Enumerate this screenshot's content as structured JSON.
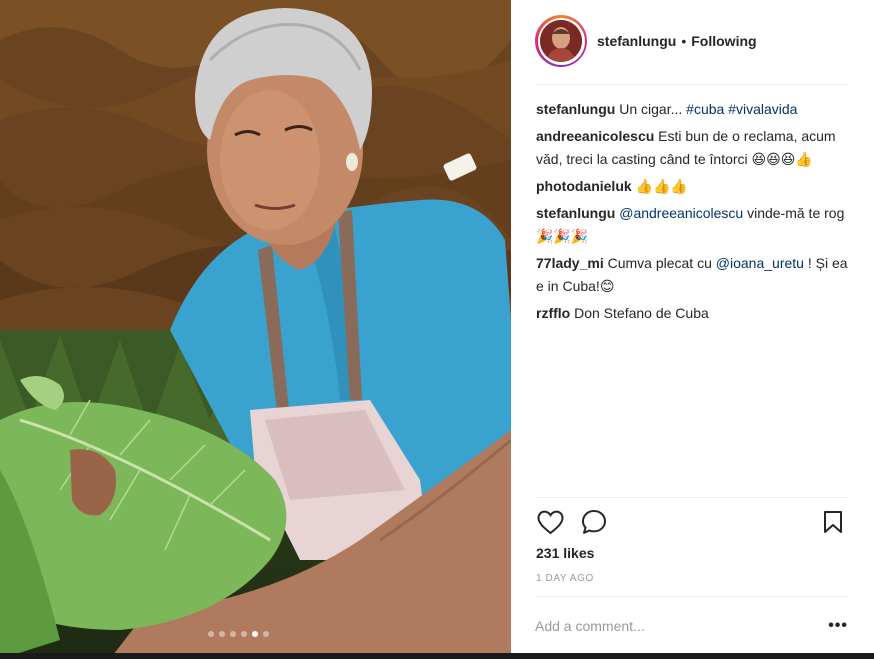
{
  "post": {
    "username": "stefanlungu",
    "separator": "•",
    "follow_status": "Following",
    "avatar_icon": "avatar-photo"
  },
  "comments": [
    {
      "user": "stefanlungu",
      "parts": [
        {
          "t": " Un cigar... "
        },
        {
          "tag": "#cuba"
        },
        {
          "t": " "
        },
        {
          "tag": "#vivalavida"
        }
      ]
    },
    {
      "user": "andreeanicolescu",
      "parts": [
        {
          "t": " Esti bun de o reclama, acum văd, treci la casting când te întorci 😆😆😆👍"
        }
      ]
    },
    {
      "user": "photodanieluk",
      "parts": [
        {
          "t": " 👍👍👍"
        }
      ]
    },
    {
      "user": "stefanlungu",
      "parts": [
        {
          "t": " "
        },
        {
          "tag": "@andreeanicolescu"
        },
        {
          "t": " vinde-mă te rog 🎉🎉🎉"
        }
      ]
    },
    {
      "user": "77lady_mi",
      "parts": [
        {
          "t": " Cumva plecat cu "
        },
        {
          "tag": "@ioana_uretu"
        },
        {
          "t": " ! Și ea e in Cuba!😊"
        }
      ]
    },
    {
      "user": "rzfflo",
      "parts": [
        {
          "t": " Don Stefano de Cuba"
        }
      ]
    }
  ],
  "actions": {
    "like_icon": "heart-icon",
    "comment_icon": "comment-bubble-icon",
    "save_icon": "bookmark-icon"
  },
  "likes": "231 likes",
  "timestamp": "1 DAY AGO",
  "add_comment": {
    "placeholder": "Add a comment...",
    "more_label": "•••"
  },
  "carousel": {
    "count": 6,
    "active_index": 4
  },
  "colors": {
    "link": "#003569",
    "muted": "#999999",
    "text": "#262626"
  }
}
